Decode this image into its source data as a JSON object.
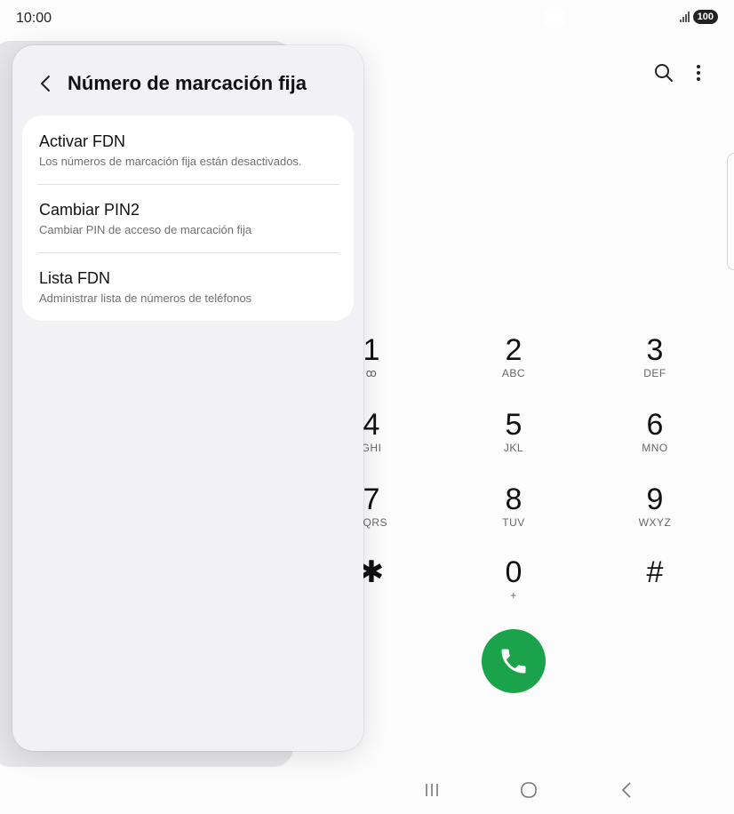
{
  "status_bar": {
    "time": "10:00",
    "battery": "100"
  },
  "dialer": {
    "keys": [
      {
        "digit": "1",
        "letters": "ꝏ"
      },
      {
        "digit": "2",
        "letters": "ABC"
      },
      {
        "digit": "3",
        "letters": "DEF"
      },
      {
        "digit": "4",
        "letters": "GHI"
      },
      {
        "digit": "5",
        "letters": "JKL"
      },
      {
        "digit": "6",
        "letters": "MNO"
      },
      {
        "digit": "7",
        "letters": "PQRS"
      },
      {
        "digit": "8",
        "letters": "TUV"
      },
      {
        "digit": "9",
        "letters": "WXYZ"
      },
      {
        "digit": "✱",
        "letters": ""
      },
      {
        "digit": "0",
        "letters": "+"
      },
      {
        "digit": "#",
        "letters": ""
      }
    ],
    "call_color": "#1aa34a"
  },
  "panel": {
    "title": "Número de marcación fija",
    "items": [
      {
        "title": "Activar FDN",
        "subtitle": "Los números de marcación fija están desactivados."
      },
      {
        "title": "Cambiar PIN2",
        "subtitle": "Cambiar PIN de acceso de marcación fija"
      },
      {
        "title": "Lista FDN",
        "subtitle": "Administrar lista de números de teléfonos"
      }
    ]
  },
  "icons": {
    "search": "search-icon",
    "more": "more-vert-icon",
    "back": "chevron-left-icon",
    "call": "phone-icon",
    "recents": "recent-apps-icon",
    "home": "home-icon",
    "nav_back": "nav-back-icon"
  }
}
